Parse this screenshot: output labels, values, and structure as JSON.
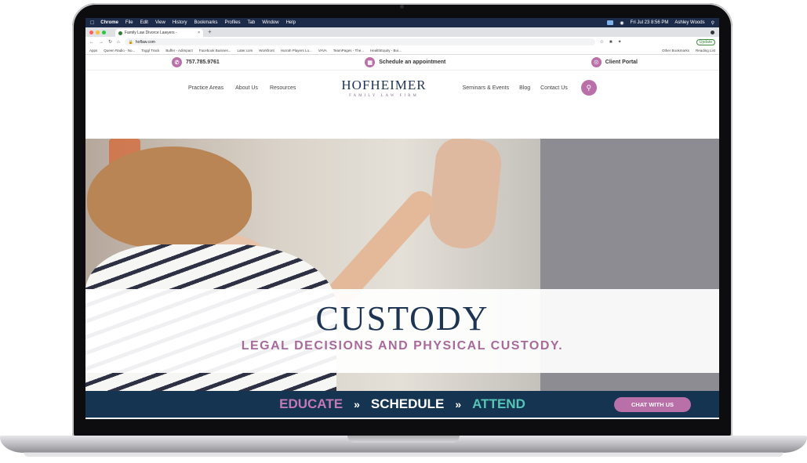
{
  "menubar": {
    "apple": "",
    "items": [
      "Chrome",
      "File",
      "Edit",
      "View",
      "History",
      "Bookmarks",
      "Profiles",
      "Tab",
      "Window",
      "Help"
    ],
    "clock": "Fri Jul 23  8:56 PM",
    "user": "Ashley Woods"
  },
  "browser": {
    "tab_title": "Family Law Divorce Lawyers - ",
    "tab_close": "×",
    "new_tab": "+",
    "url": "hoflaw.com",
    "update_label": "Update",
    "bookmarks": [
      "Apps",
      "Queen Radio - No...",
      "Toggl Track",
      "Buffer - Adimpact",
      "Facebook Busines...",
      "Later.com",
      "Workfront",
      "Hurrah Players Lo...",
      "VAVA",
      "TeamPages - The...",
      "HealthEquity - Bui..."
    ],
    "bookmarks_right": [
      "Other Bookmarks",
      "Reading List"
    ]
  },
  "site": {
    "topbar": {
      "phone": "757.785.9761",
      "schedule": "Schedule an appointment",
      "portal": "Client Portal"
    },
    "nav_left": [
      "Practice Areas",
      "About Us",
      "Resources"
    ],
    "logo_main": "HOFHEIMER",
    "logo_sub": "FAMILY LAW FIRM",
    "nav_right": [
      "Seminars & Events",
      "Blog",
      "Contact Us"
    ],
    "hero": {
      "title": "CUSTODY",
      "subtitle": "LEGAL DECISIONS AND PHYSICAL CUSTODY."
    },
    "cta": {
      "educate": "EDUCATE",
      "schedule": "SCHEDULE",
      "attend": "ATTEND",
      "separator": "»",
      "chat": "CHAT WITH US"
    }
  },
  "colors": {
    "navy": "#1d3452",
    "plum": "#b96fa8",
    "teal": "#56c4b6",
    "strip": "#143451"
  }
}
